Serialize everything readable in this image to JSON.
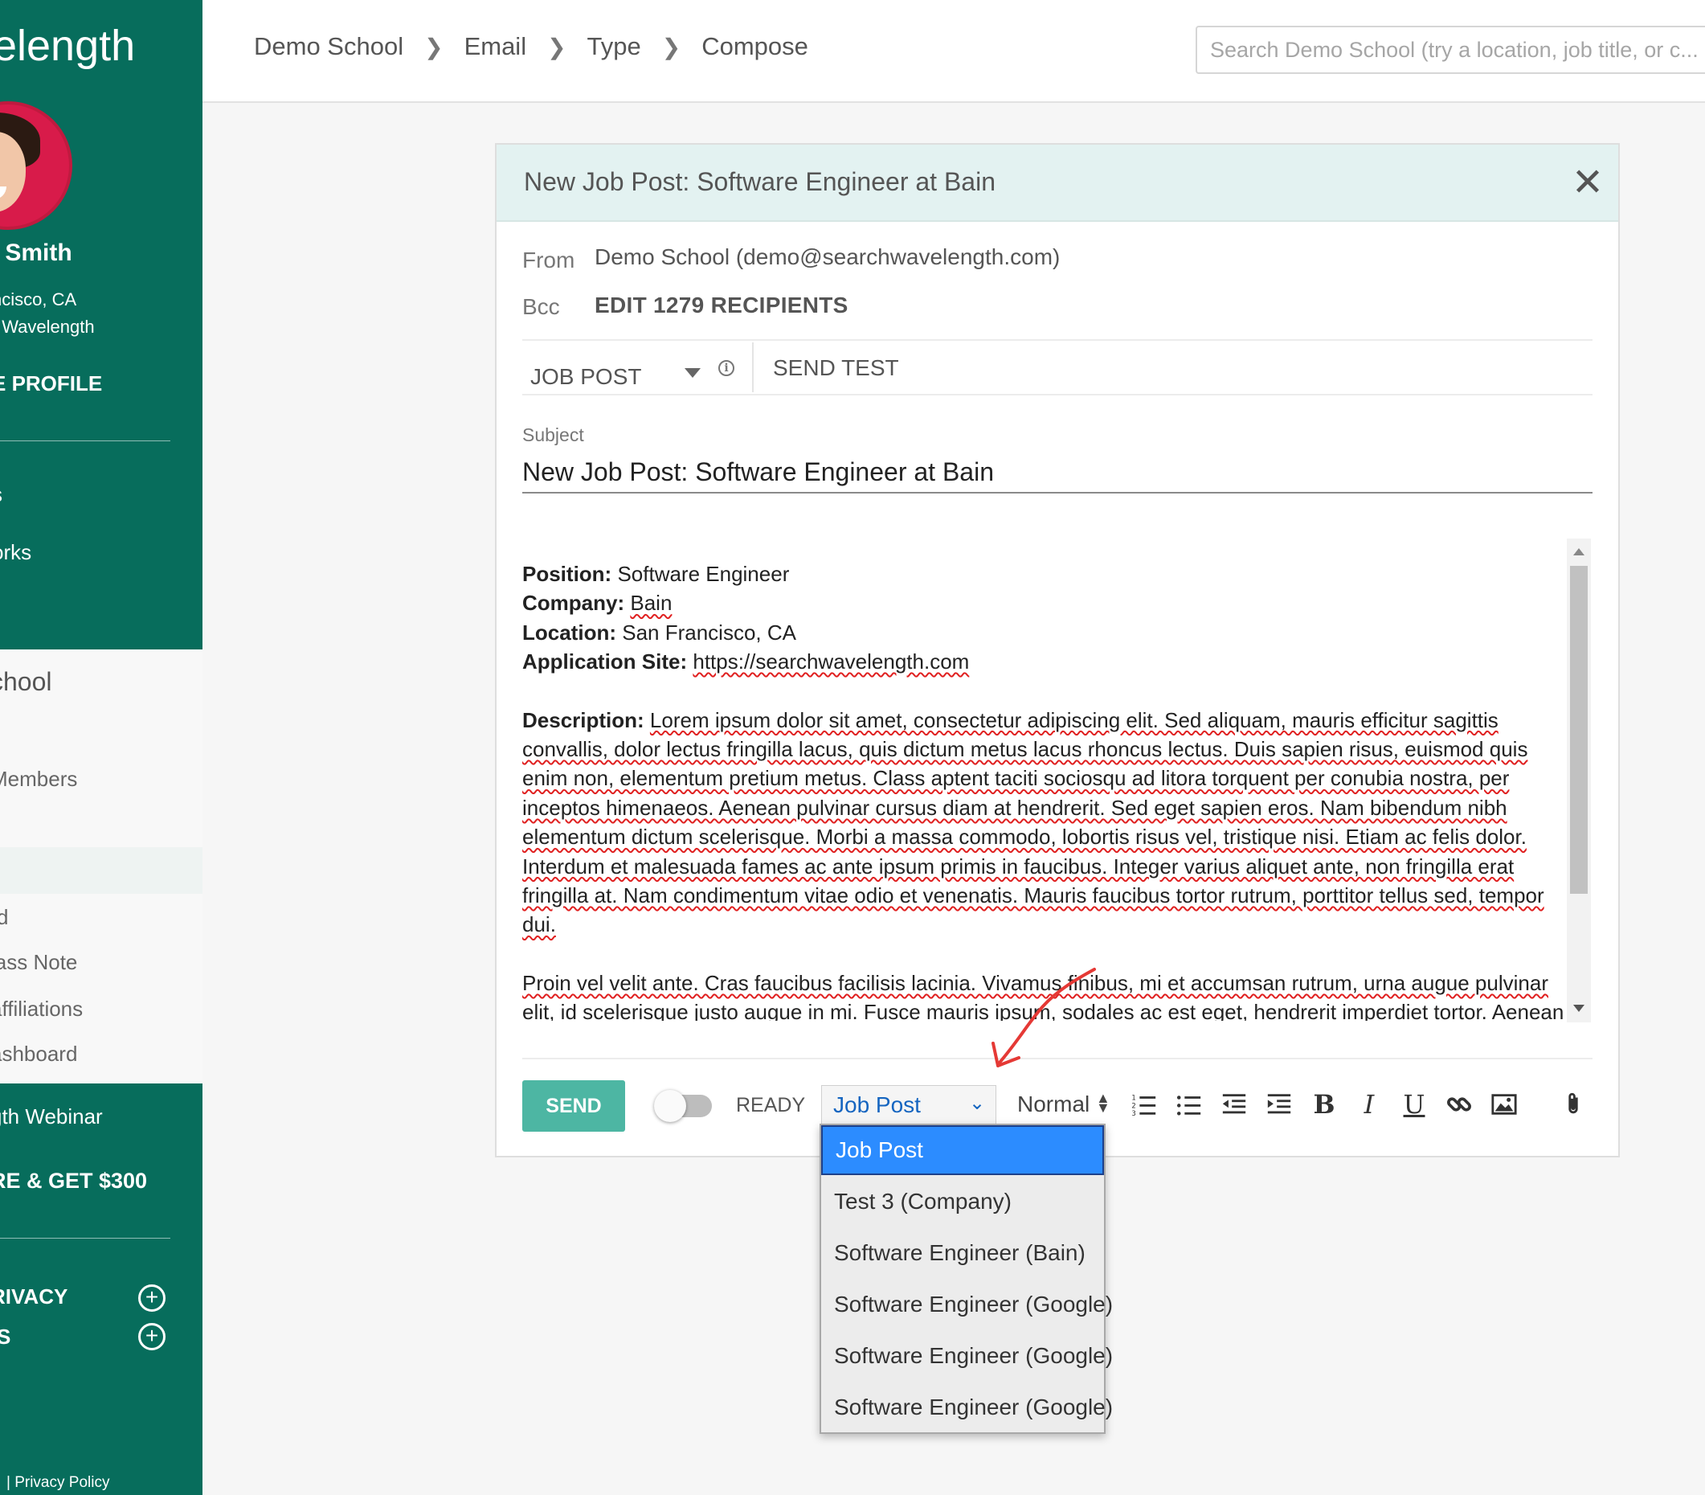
{
  "sidebar": {
    "brand": "velength",
    "user_name": "t Smith",
    "location": "ncisco, CA",
    "org": "t Wavelength",
    "profile_link": "E PROFILE",
    "nav_1": "s",
    "nav_2": "orks",
    "school": "chool",
    "members": "Members",
    "item_d": "d",
    "class_note": "lass Note",
    "affiliations": "affiliations",
    "dashboard": "ashboard",
    "webinar": "gth Webinar",
    "refer": "RE & GET $300",
    "privacy_row": "RIVACY",
    "s_row": "S",
    "footer": "|   Privacy Policy"
  },
  "header": {
    "breadcrumb": [
      "Demo School",
      "Email",
      "Type",
      "Compose"
    ],
    "search_placeholder": "Search Demo School (try a location, job title, or c..."
  },
  "compose": {
    "title": "New Job Post: Software Engineer at Bain",
    "from_label": "From",
    "from_value": "Demo School (demo@searchwavelength.com)",
    "bcc_label": "Bcc",
    "bcc_value": "EDIT 1279 RECIPIENTS",
    "template_type": "JOB POST",
    "send_test": "SEND TEST",
    "subject_label": "Subject",
    "subject_value": "New Job Post: Software Engineer at Bain",
    "body": {
      "position_label": "Position:",
      "position": " Software Engineer",
      "company_label": "Company:",
      "company": "Bain",
      "location_label": "Location:",
      "location": " San Francisco, CA",
      "site_label": "Application Site:",
      "site": "https://searchwavelength.com",
      "desc_label": "Description:",
      "desc_lines": [
        "Lorem ipsum dolor sit amet, consectetur adipiscing elit. Sed aliquam, mauris efficitur sagittis",
        "convallis, dolor lectus fringilla lacus, quis dictum metus lacus rhoncus lectus. Duis sapien risus, euismod quis",
        "enim non, elementum pretium metus. Class aptent taciti sociosqu ad litora torquent per conubia nostra, per",
        "inceptos himenaeos. Aenean pulvinar cursus diam at hendrerit. Sed eget sapien eros. Nam bibendum nibh",
        "elementum dictum scelerisque. Morbi a massa commodo, lobortis risus vel, tristique nisi. Etiam ac felis dolor.",
        "Interdum et malesuada fames ac ante ipsum primis in faucibus. Integer varius aliquet ante, non fringilla erat",
        "fringilla at. Nam condimentum vitae odio et venenatis. Mauris faucibus tortor rutrum, porttitor tellus sed, tempor",
        "dui."
      ],
      "para2_lines": [
        "Proin vel velit ante. Cras faucibus facilisis lacinia. Vivamus finibus, mi et accumsan rutrum, urna augue pulvinar",
        "elit, id scelerisque justo augue in mi. Fusce mauris ipsum, sodales ac est eget, hendrerit imperdiet tortor. Aenean"
      ]
    },
    "send_label": "SEND",
    "ready_label": "READY",
    "template_select": "Job Post",
    "format_select": "Normal",
    "toolbar_icons": [
      "ordered-list-icon",
      "bullet-list-icon",
      "outdent-icon",
      "indent-icon",
      "bold-icon",
      "italic-icon",
      "underline-icon",
      "link-icon",
      "image-icon",
      "attachment-icon"
    ],
    "toolbar_text": {
      "bold": "B",
      "italic": "I",
      "underline": "U"
    }
  },
  "dropdown": {
    "options": [
      "Job Post",
      "Test 3 (Company)",
      "Software Engineer (Bain)",
      "Software Engineer (Google)",
      "Software Engineer (Google)",
      "Software Engineer (Google)"
    ],
    "selected": "Job Post"
  },
  "colors": {
    "sidebar_green": "#076d5c",
    "send_button": "#4db6a3",
    "dropdown_highlight": "#2c8cff",
    "annotation_arrow": "#e53935"
  }
}
